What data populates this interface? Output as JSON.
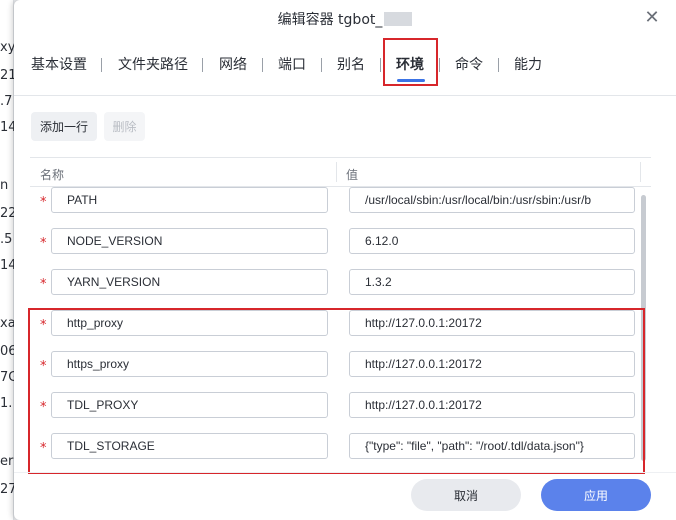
{
  "background": {
    "fragments": [
      "xy",
      "21",
      ".7",
      "14",
      "n",
      "22",
      ".5",
      "14",
      "xa",
      "06",
      "7G",
      "1.",
      "er",
      "27"
    ]
  },
  "dialog": {
    "title": "编辑容器 tgbot_",
    "close_icon": "close-icon"
  },
  "tabs": [
    {
      "label": "基本设置"
    },
    {
      "label": "文件夹路径"
    },
    {
      "label": "网络"
    },
    {
      "label": "端口"
    },
    {
      "label": "别名"
    },
    {
      "label": "环境",
      "active": true
    },
    {
      "label": "命令"
    },
    {
      "label": "能力"
    }
  ],
  "toolbar": {
    "add_label": "添加一行",
    "delete_label": "删除"
  },
  "table": {
    "columns": [
      "名称",
      "值"
    ],
    "required_mark": "*",
    "rows": [
      {
        "name": "PATH",
        "value": "/usr/local/sbin:/usr/local/bin:/usr/sbin:/usr/b"
      },
      {
        "name": "NODE_VERSION",
        "value": "6.12.0"
      },
      {
        "name": "YARN_VERSION",
        "value": "1.3.2"
      },
      {
        "name": "http_proxy",
        "value": "http://127.0.0.1:20172"
      },
      {
        "name": "https_proxy",
        "value": "http://127.0.0.1:20172"
      },
      {
        "name": "TDL_PROXY",
        "value": "http://127.0.0.1:20172"
      },
      {
        "name": "TDL_STORAGE",
        "value": "{\"type\": \"file\", \"path\": \"/root/.tdl/data.json\"}"
      }
    ]
  },
  "footer": {
    "cancel_label": "取消",
    "apply_label": "应用"
  },
  "colors": {
    "accent": "#3b73e6",
    "apply_button": "#5b82eb",
    "highlight": "#d7262b",
    "required": "#d7262b"
  }
}
